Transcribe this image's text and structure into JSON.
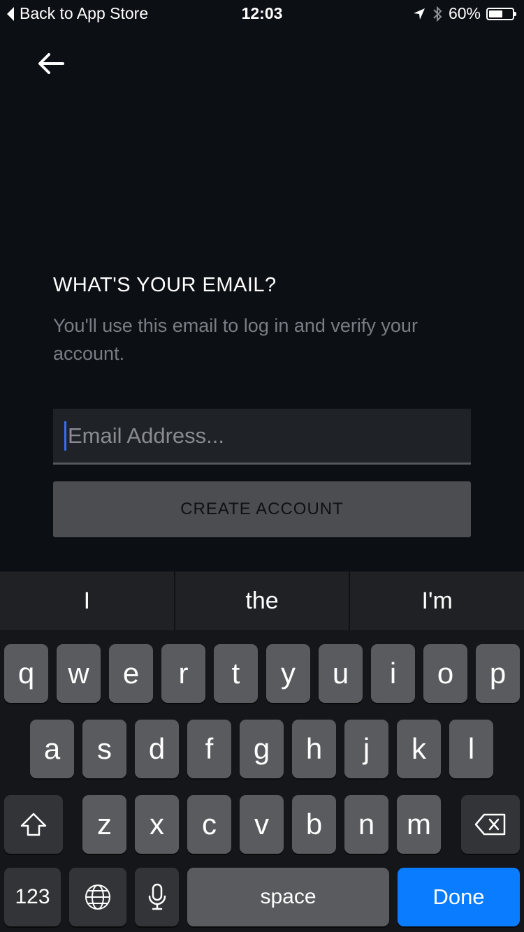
{
  "status_bar": {
    "back_label": "Back to App Store",
    "time": "12:03",
    "battery_text": "60%",
    "battery_level": 0.6
  },
  "content": {
    "title": "WHAT'S YOUR EMAIL?",
    "subtitle": "You'll use this email to log in and verify your account.",
    "email_placeholder": "Email Address...",
    "create_button": "CREATE ACCOUNT"
  },
  "keyboard": {
    "suggestions": [
      "I",
      "the",
      "I'm"
    ],
    "row1": [
      "q",
      "w",
      "e",
      "r",
      "t",
      "y",
      "u",
      "i",
      "o",
      "p"
    ],
    "row2": [
      "a",
      "s",
      "d",
      "f",
      "g",
      "h",
      "j",
      "k",
      "l"
    ],
    "row3": [
      "z",
      "x",
      "c",
      "v",
      "b",
      "n",
      "m"
    ],
    "numbers_label": "123",
    "space_label": "space",
    "done_label": "Done"
  },
  "colors": {
    "background": "#0c0f14",
    "caret": "#3b6cf0",
    "done_key": "#0a7cff"
  }
}
